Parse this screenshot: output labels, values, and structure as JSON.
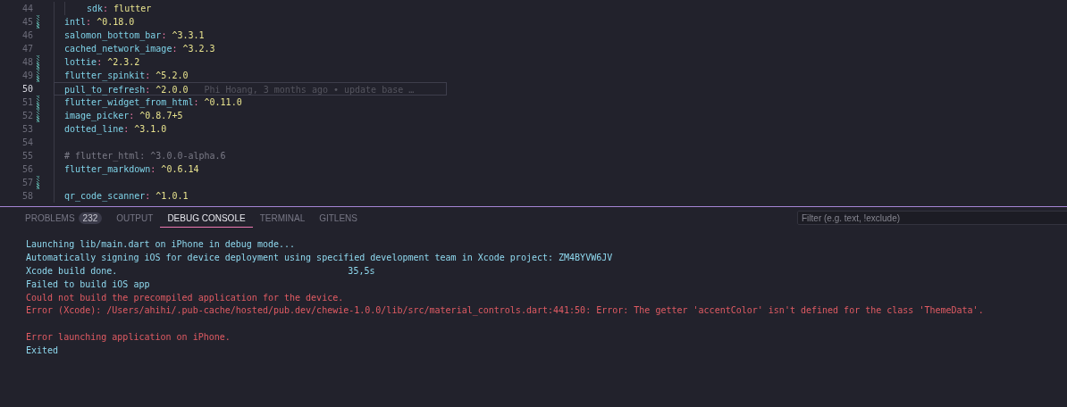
{
  "editor": {
    "lines": [
      {
        "number": "44",
        "kind": "nested-entry",
        "key": "sdk",
        "separator": ":",
        "value": "flutter",
        "modified": false,
        "current": false
      },
      {
        "number": "45",
        "kind": "entry",
        "key": "intl",
        "separator": ":",
        "value": "^0.18.0",
        "modified": true,
        "current": false
      },
      {
        "number": "46",
        "kind": "entry",
        "key": "salomon_bottom_bar",
        "separator": ":",
        "value": "^3.3.1",
        "modified": false,
        "current": false
      },
      {
        "number": "47",
        "kind": "entry",
        "key": "cached_network_image",
        "separator": ":",
        "value": "^3.2.3",
        "modified": false,
        "current": false
      },
      {
        "number": "48",
        "kind": "entry",
        "key": "lottie",
        "separator": ":",
        "value": "^2.3.2",
        "modified": true,
        "current": false
      },
      {
        "number": "49",
        "kind": "entry",
        "key": "flutter_spinkit",
        "separator": ":",
        "value": "^5.2.0",
        "modified": true,
        "current": false
      },
      {
        "number": "50",
        "kind": "entry",
        "key": "pull_to_refresh",
        "separator": ":",
        "value": "^2.0.0",
        "modified": false,
        "current": true,
        "blame": "Phi Hoang, 3 months ago • update base …"
      },
      {
        "number": "51",
        "kind": "entry",
        "key": "flutter_widget_from_html",
        "separator": ":",
        "value": "^0.11.0",
        "modified": true,
        "current": false
      },
      {
        "number": "52",
        "kind": "entry",
        "key": "image_picker",
        "separator": ":",
        "value": "^0.8.7+5",
        "modified": true,
        "current": false
      },
      {
        "number": "53",
        "kind": "entry",
        "key": "dotted_line",
        "separator": ":",
        "value": "^3.1.0",
        "modified": false,
        "current": false
      },
      {
        "number": "54",
        "kind": "blank",
        "modified": false,
        "current": false
      },
      {
        "number": "55",
        "kind": "comment",
        "text": "# flutter_html: ^3.0.0-alpha.6",
        "modified": false,
        "current": false
      },
      {
        "number": "56",
        "kind": "entry",
        "key": "flutter_markdown",
        "separator": ":",
        "value": "^0.6.14",
        "modified": false,
        "current": false
      },
      {
        "number": "57",
        "kind": "blank",
        "modified": true,
        "current": false
      },
      {
        "number": "58",
        "kind": "entry",
        "key": "qr_code_scanner",
        "separator": ":",
        "value": "^1.0.1",
        "modified": false,
        "current": false
      }
    ]
  },
  "panel": {
    "tabs": [
      {
        "label": "PROBLEMS",
        "badge": "232",
        "selected": false
      },
      {
        "label": "OUTPUT",
        "selected": false
      },
      {
        "label": "DEBUG CONSOLE",
        "selected": true
      },
      {
        "label": "TERMINAL",
        "selected": false
      },
      {
        "label": "GITLENS",
        "selected": false
      }
    ],
    "filter": {
      "placeholder": "Filter (e.g. text, !exclude)"
    },
    "console": [
      {
        "kind": "info",
        "text": "Launching lib/main.dart on iPhone in debug mode..."
      },
      {
        "kind": "info",
        "text": "Automatically signing iOS for device deployment using specified development team in Xcode project: ZM4BYVW6JV"
      },
      {
        "kind": "info",
        "text": "Xcode build done.",
        "trailing": "35,5s"
      },
      {
        "kind": "info",
        "text": "Failed to build iOS app"
      },
      {
        "kind": "error",
        "text": "Could not build the precompiled application for the device."
      },
      {
        "kind": "error",
        "text": "Error (Xcode): /Users/ahihi/.pub-cache/hosted/pub.dev/chewie-1.0.0/lib/src/material_controls.dart:441:50: Error: The getter 'accentColor' isn't defined for the class 'ThemeData'."
      },
      {
        "kind": "blank"
      },
      {
        "kind": "error",
        "text": "Error launching application on iPhone."
      },
      {
        "kind": "info",
        "text": "Exited"
      }
    ]
  }
}
